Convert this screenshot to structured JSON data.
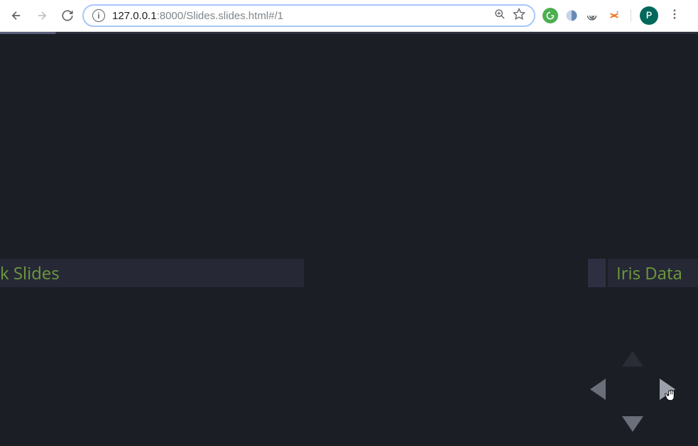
{
  "browser": {
    "url_host": "127.0.0.1",
    "url_port_path": ":8000/Slides.slides.html#/1",
    "avatar_initial": "P",
    "info_glyph": "i"
  },
  "slides": {
    "left_fragment": "k Slides",
    "right_fragment": "Iris Data"
  }
}
